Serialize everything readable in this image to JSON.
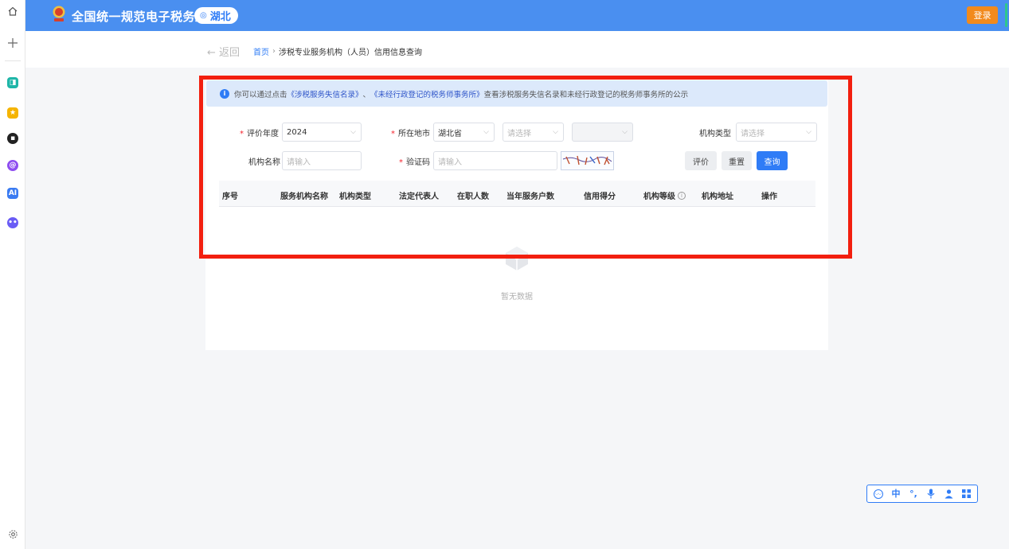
{
  "header": {
    "site_title": "全国统一规范电子税务局",
    "region": "湖北",
    "login_label": "登录"
  },
  "left_bar": {
    "icons": [
      "home-icon",
      "plus-icon",
      "app-icon",
      "star-icon",
      "chat-icon",
      "ai-swirl-icon",
      "ai-icon",
      "bot-icon",
      "settings-icon"
    ]
  },
  "breadcrumb": {
    "back_label": "返回",
    "home_label": "首页",
    "separator": "›",
    "current_label": "涉税专业服务机构（人员）信用信息查询"
  },
  "notice": {
    "prefix": "你可以通过点击",
    "link1": "《涉税服务失信名录》",
    "middle": "、",
    "link2": "《未经行政登记的税务师事务所》",
    "suffix": "查看涉税服务失信名录和未经行政登记的税务师事务所的公示"
  },
  "form": {
    "year_label": "评价年度",
    "year_value": "2024",
    "location_label": "所在地市",
    "province_value": "湖北省",
    "city_placeholder": "请选择",
    "district_value": "",
    "org_type_label": "机构类型",
    "org_type_placeholder": "请选择",
    "org_name_label": "机构名称",
    "org_name_placeholder": "请输入",
    "captcha_label": "验证码",
    "captcha_placeholder": "请输入"
  },
  "buttons": {
    "evaluate": "评价",
    "reset": "重置",
    "query": "查询"
  },
  "table": {
    "columns": [
      "序号",
      "服务机构名称",
      "机构类型",
      "法定代表人",
      "在职人数",
      "当年服务户数",
      "信用得分",
      "机构等级",
      "机构地址",
      "操作"
    ],
    "tooltip_glyph": "i",
    "empty_text": "暂无数据"
  },
  "float_toolbar": {
    "items": [
      "accessibility-icon",
      "中",
      "°,",
      "mic-icon",
      "user-icon",
      "grid-icon"
    ]
  },
  "colors": {
    "primary": "#4a8ff0",
    "accent_blue": "#2f7cf6",
    "login_orange": "#f28a1c",
    "highlight_red": "#f21f0f",
    "notice_bg": "#dce9fb"
  }
}
